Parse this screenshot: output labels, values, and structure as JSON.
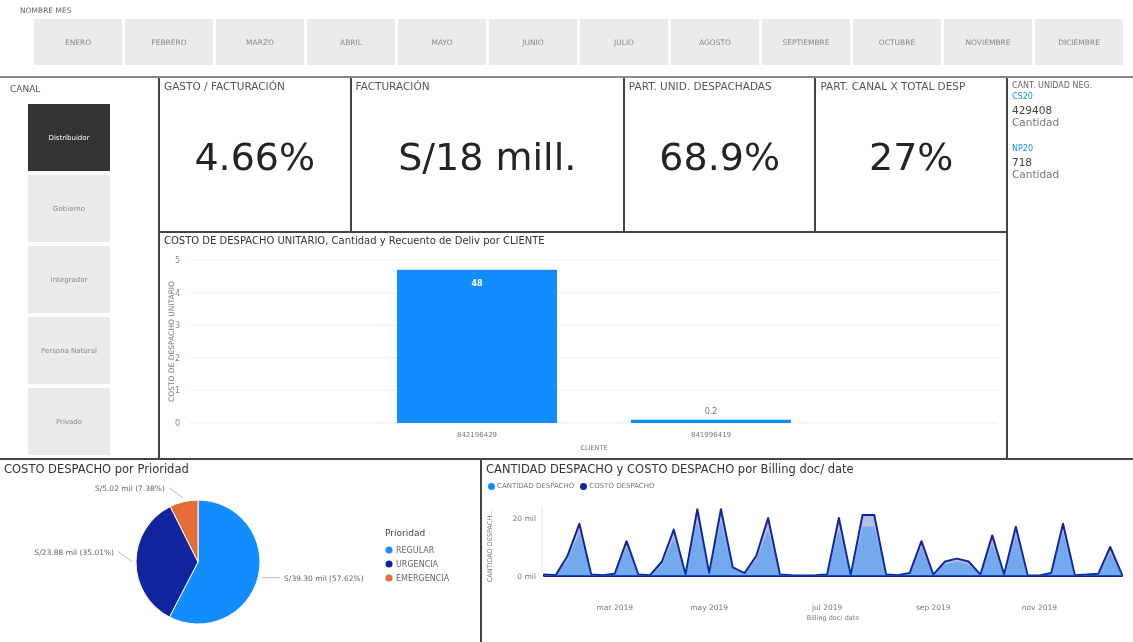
{
  "month_slicer": {
    "title": "NOMBRE MES",
    "months": [
      {
        "label": "ENERO",
        "selected": false
      },
      {
        "label": "FEBRERO",
        "selected": false
      },
      {
        "label": "MARZO",
        "selected": false
      },
      {
        "label": "ABRIL",
        "selected": false
      },
      {
        "label": "MAYO",
        "selected": false
      },
      {
        "label": "JUNIO",
        "selected": false
      },
      {
        "label": "JULIO",
        "selected": false
      },
      {
        "label": "AGOSTO",
        "selected": false
      },
      {
        "label": "SEPTIEMBRE",
        "selected": false
      },
      {
        "label": "OCTUBRE",
        "selected": false
      },
      {
        "label": "NOVIEMBRE",
        "selected": false
      },
      {
        "label": "DICIEMBRE",
        "selected": false
      }
    ]
  },
  "canal_slicer": {
    "title": "CANAL",
    "items": [
      {
        "label": "Distribuidor",
        "selected": true
      },
      {
        "label": "Gobierno",
        "selected": false
      },
      {
        "label": "Integrador",
        "selected": false
      },
      {
        "label": "Persona Natural",
        "selected": false
      },
      {
        "label": "Privado",
        "selected": false
      }
    ]
  },
  "kpis": [
    {
      "title": "GASTO / FACTURACIÓN",
      "value": "4.66%"
    },
    {
      "title": "FACTURACIÓN",
      "value": "S/18 mill."
    },
    {
      "title": "PART. UNID. DESPACHADAS",
      "value": "68.9%"
    },
    {
      "title": "PART. CANAL X TOTAL DESP",
      "value": "27%"
    }
  ],
  "unit_panel": {
    "title": "CANT. UNIDAD NEG.",
    "units": [
      {
        "name": "CS20",
        "value": "429408",
        "caption": "Cantidad"
      },
      {
        "name": "NP20",
        "value": "718",
        "caption": "Cantidad"
      }
    ]
  },
  "bar_panel": {
    "title": "COSTO DE DESPACHO UNITARIO, Cantidad y Recuento de Deliv por CLIENTE",
    "chart_data": {
      "type": "bar",
      "xlabel": "CLIENTE",
      "ylabel": "COSTO DE DESPACHO UNITARIO",
      "categories": [
        "842196429",
        "841996419"
      ],
      "series": [
        {
          "color": "#118dff",
          "values": [
            4.7,
            0.1
          ]
        }
      ],
      "ylim": [
        0,
        5
      ],
      "yticks": [
        0,
        1,
        2,
        3,
        4,
        5
      ],
      "grid": true,
      "value_labels": [
        "48",
        "0.2"
      ]
    }
  },
  "pie_panel": {
    "title": "COSTO DESPACHO por Prioridad",
    "chart_data": {
      "type": "pie",
      "legend": true,
      "legend_title": "Prioridad",
      "categories": [
        "REGULAR",
        "URGENCIA",
        "EMERGENCIA"
      ],
      "values": [
        57.62,
        35.01,
        7.38
      ],
      "colors": [
        "#118dff",
        "#12239e",
        "#e66c37"
      ],
      "value_labels": [
        "S/39.30 mil (57.62%)",
        "S/23.88 mil (35.01%)",
        "S/5.02 mil (7.38%)"
      ]
    }
  },
  "line_panel": {
    "title": "CANTIDAD DESPACHO y COSTO DESPACHO por Billing doc/ date",
    "chart_data": {
      "type": "area",
      "xlabel": "Billing doc/ date",
      "ylabel": "CANTIDAD DESPACH...",
      "legend": true,
      "categories": [
        null,
        null,
        null,
        null,
        null,
        null,
        "mar 2019",
        null,
        null,
        null,
        null,
        null,
        null,
        null,
        "may 2019",
        null,
        null,
        null,
        null,
        null,
        null,
        null,
        null,
        null,
        "jul 2019",
        null,
        null,
        null,
        null,
        null,
        null,
        null,
        null,
        "sep 2019",
        null,
        null,
        null,
        null,
        null,
        null,
        null,
        null,
        "nov 2019",
        null,
        null,
        null,
        null,
        null,
        null,
        null
      ],
      "ylim": [
        0,
        24
      ],
      "yticks": [
        {
          "value": 0,
          "label": "0 mil"
        },
        {
          "value": 20,
          "label": "20 mil"
        }
      ],
      "series": [
        {
          "name": "CANTIDAD DESPACHO",
          "color": "#118dff",
          "values": [
            0.4,
            0.2,
            5.5,
            15,
            0.4,
            0.2,
            0.6,
            10,
            0.4,
            0.2,
            4,
            13,
            0.4,
            19,
            0.8,
            19,
            2.5,
            0.8,
            5.5,
            16,
            0.4,
            0.2,
            0.1,
            0.2,
            0.4,
            16,
            0.2,
            17,
            17,
            0.4,
            0.2,
            0.8,
            10,
            0.4,
            4,
            5,
            4,
            0.4,
            11,
            0.4,
            14,
            0.2,
            0.1,
            0.8,
            15,
            0.2,
            0.4,
            0.6,
            8,
            0.4
          ]
        },
        {
          "name": "COSTO DESPACHO",
          "color": "#12239e",
          "values": [
            0.5,
            0.3,
            7,
            18,
            0.5,
            0.3,
            0.8,
            12,
            0.5,
            0.3,
            5,
            16,
            0.5,
            23,
            1,
            23,
            3,
            1,
            7,
            20,
            0.5,
            0.3,
            0.2,
            0.3,
            0.5,
            20,
            0.3,
            21,
            21,
            0.5,
            0.3,
            1,
            12,
            0.5,
            5,
            6,
            5,
            0.5,
            14,
            0.5,
            17,
            0.3,
            0.2,
            1,
            18,
            0.3,
            0.5,
            0.8,
            10,
            0.5
          ]
        }
      ]
    }
  }
}
